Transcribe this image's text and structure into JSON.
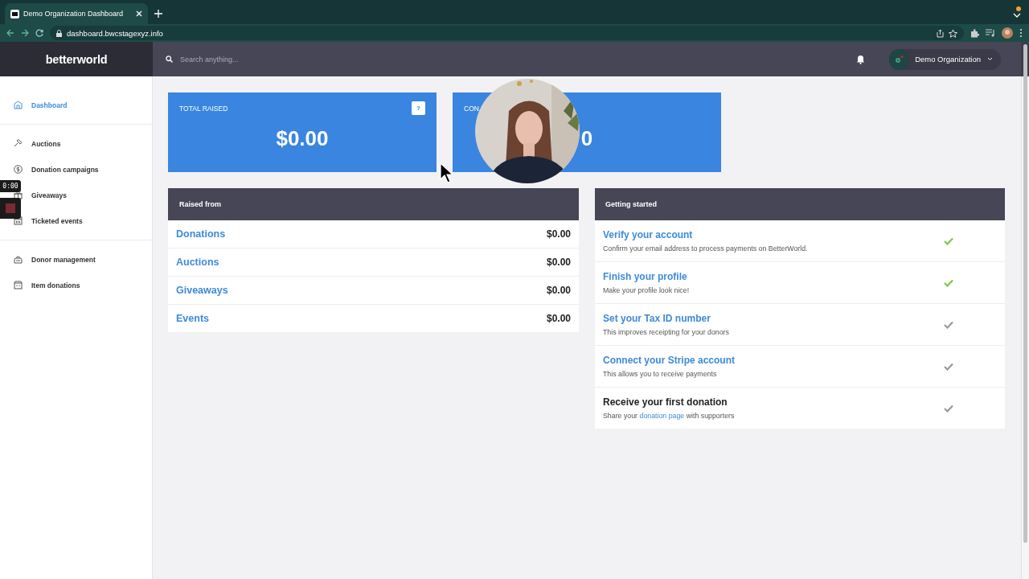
{
  "browser": {
    "tab_title": "Demo Organization Dashboard",
    "address": "dashboard.bwcstagexyz.info"
  },
  "header": {
    "logo": "betterworld",
    "search": {
      "placeholder": "Search anything..."
    },
    "organization": "Demo Organization"
  },
  "sidebar": {
    "groups": [
      [
        {
          "label": "Dashboard",
          "selected": true
        }
      ],
      [
        {
          "label": "Auctions",
          "selected": false
        },
        {
          "label": "Donation campaigns",
          "selected": false
        },
        {
          "label": "Giveaways",
          "selected": false
        },
        {
          "label": "Ticketed events",
          "selected": false
        }
      ],
      [
        {
          "label": "Donor management",
          "selected": false
        },
        {
          "label": "Item donations",
          "selected": false
        }
      ]
    ]
  },
  "recorder": {
    "time": "0:00"
  },
  "stats": [
    {
      "label": "TOTAL RAISED",
      "value": "$0.00",
      "help": "?"
    },
    {
      "label": "CON",
      "value": "0"
    }
  ],
  "raised_from": {
    "title": "Raised from",
    "rows": [
      {
        "label": "Donations",
        "amount": "$0.00"
      },
      {
        "label": "Auctions",
        "amount": "$0.00"
      },
      {
        "label": "Giveaways",
        "amount": "$0.00"
      },
      {
        "label": "Events",
        "amount": "$0.00"
      }
    ]
  },
  "getting_started": {
    "title": "Getting started",
    "tasks": [
      {
        "kind": "link",
        "title": "Verify your account",
        "description": [
          {
            "kind": "text",
            "text": "Confirm your email address to process payments on BetterWorld."
          }
        ],
        "done": true
      },
      {
        "kind": "link",
        "title": "Finish your profile",
        "description": [
          {
            "kind": "text",
            "text": "Make your profile look nice!"
          }
        ],
        "done": true
      },
      {
        "kind": "link",
        "title": "Set your Tax ID number",
        "description": [
          {
            "kind": "text",
            "text": "This improves receipting for your donors"
          }
        ],
        "done": false
      },
      {
        "kind": "link",
        "title": "Connect your Stripe account",
        "description": [
          {
            "kind": "text",
            "text": "This allows you to receive payments"
          }
        ],
        "done": false
      },
      {
        "kind": "plain",
        "title": "Receive your first donation",
        "description": [
          {
            "kind": "text",
            "text": "Share your "
          },
          {
            "kind": "link",
            "text": "donation page"
          },
          {
            "kind": "text",
            "text": " with supporters"
          }
        ],
        "done": false
      }
    ]
  }
}
